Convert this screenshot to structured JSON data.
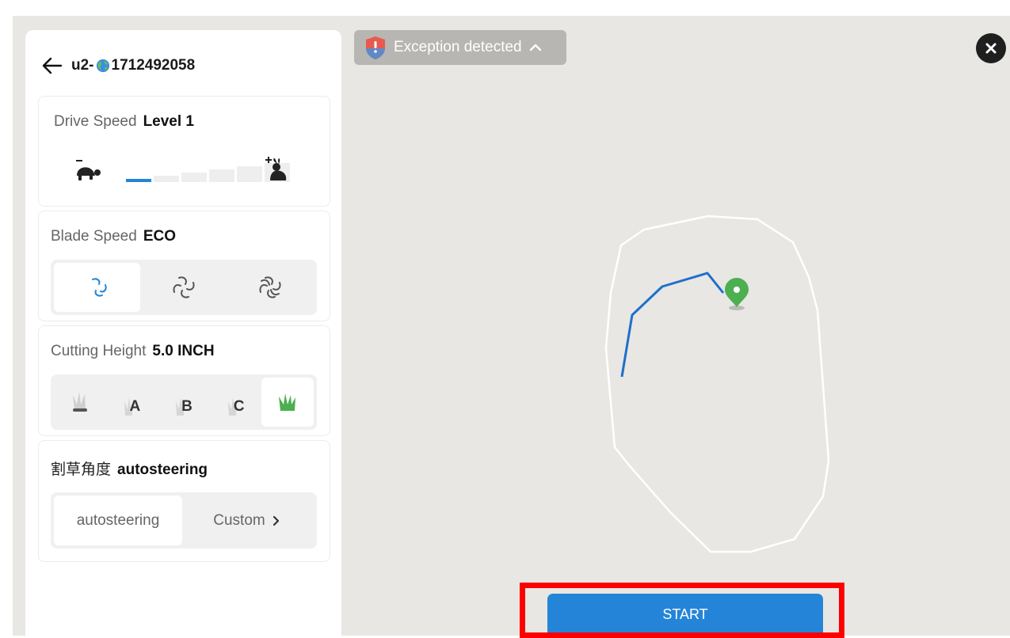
{
  "header": {
    "title_prefix": "u2-",
    "title_suffix": "1712492058"
  },
  "drive_speed": {
    "label": "Drive Speed",
    "value": "Level 1",
    "level": 1,
    "max_level": 6
  },
  "blade_speed": {
    "label": "Blade Speed",
    "value": "ECO",
    "selected_index": 0
  },
  "cutting_height": {
    "label": "Cutting Height",
    "value": "5.0 INCH",
    "options": [
      "A",
      "B",
      "C"
    ],
    "selected_index": 4
  },
  "cut_angle": {
    "label": "割草角度",
    "value": "autosteering",
    "option_auto": "autosteering",
    "option_custom": "Custom"
  },
  "exception": {
    "label": "Exception detected"
  },
  "start_button": {
    "label": "START"
  },
  "colors": {
    "accent": "#2485d8",
    "path": "#1e6fcc",
    "pin": "#4caf50",
    "highlight": "#ff0000"
  }
}
